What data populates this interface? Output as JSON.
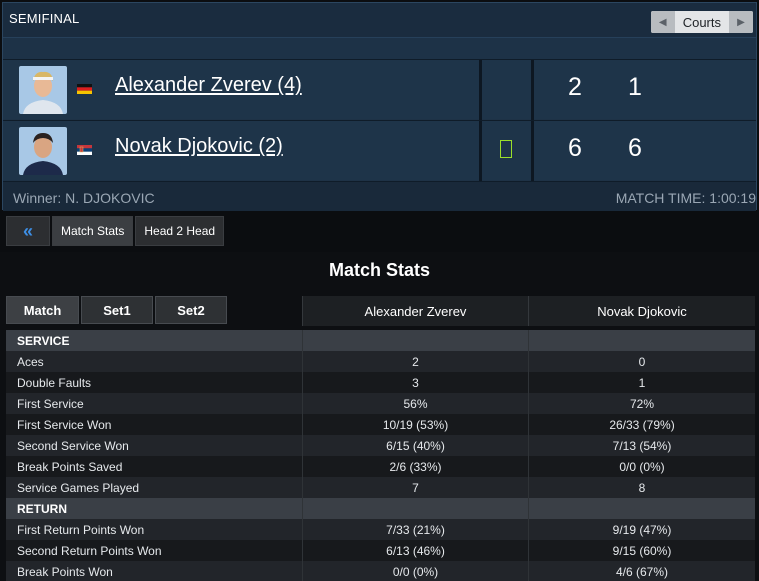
{
  "header": {
    "round": "SEMIFINAL",
    "courts_label": "Courts",
    "prev_icon": "caret-left-icon",
    "next_icon": "caret-right-icon"
  },
  "players": [
    {
      "name": "Alexander Zverev (4)",
      "flag": "Germany",
      "scores": [
        "2",
        "1"
      ],
      "serving": false
    },
    {
      "name": "Novak Djokovic (2)",
      "flag": "Serbia",
      "scores": [
        "6",
        "6"
      ],
      "serving": true
    }
  ],
  "footer": {
    "winner": "Winner: N. DJOKOVIC",
    "match_time": "MATCH TIME: 1:00:19"
  },
  "tabs": {
    "back_icon": "double-chevron-left-icon",
    "items": [
      "Match Stats",
      "Head 2 Head"
    ]
  },
  "stats": {
    "title": "Match Stats",
    "periods": [
      "Match",
      "Set1",
      "Set2"
    ],
    "players": [
      "Alexander Zverev",
      "Novak Djokovic"
    ],
    "rows": [
      {
        "type": "section",
        "label": "SERVICE"
      },
      {
        "label": "Aces",
        "p1": "2",
        "p2": "0"
      },
      {
        "label": "Double Faults",
        "p1": "3",
        "p2": "1"
      },
      {
        "label": "First Service",
        "p1": "56%",
        "p2": "72%"
      },
      {
        "label": "First Service Won",
        "p1": "10/19 (53%)",
        "p2": "26/33 (79%)"
      },
      {
        "label": "Second Service Won",
        "p1": "6/15 (40%)",
        "p2": "7/13 (54%)"
      },
      {
        "label": "Break Points Saved",
        "p1": "2/6 (33%)",
        "p2": "0/0 (0%)"
      },
      {
        "label": "Service Games Played",
        "p1": "7",
        "p2": "8"
      },
      {
        "type": "section",
        "label": "RETURN"
      },
      {
        "label": "First Return Points Won",
        "p1": "7/33 (21%)",
        "p2": "9/19 (47%)"
      },
      {
        "label": "Second Return Points Won",
        "p1": "6/13 (46%)",
        "p2": "9/15 (60%)"
      },
      {
        "label": "Break Points Won",
        "p1": "0/0 (0%)",
        "p2": "4/6 (67%)"
      }
    ]
  },
  "colors": {
    "panel": "#1e3246",
    "serve_indicator": "#9adf2a",
    "back_chevron": "#3d8fe6"
  }
}
